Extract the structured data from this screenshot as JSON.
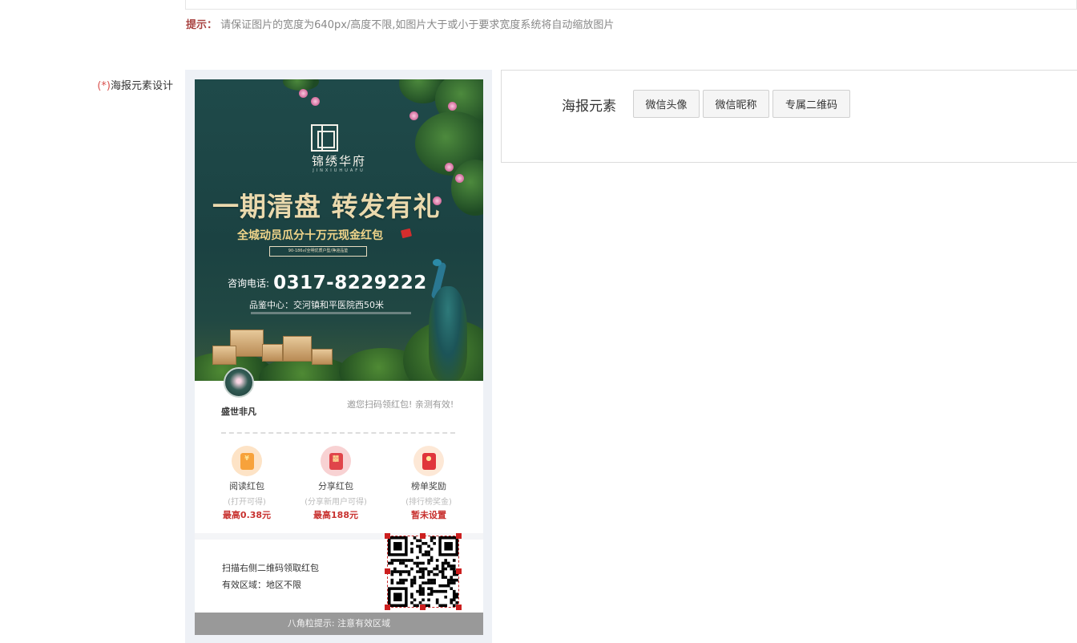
{
  "hint": {
    "label": "提示：",
    "text": "请保证图片的宽度为640px/高度不限,如图片大于或小于要求宽度系统将自动缩放图片"
  },
  "poster_field": {
    "required_mark": "(*)",
    "label": "海报元素设计"
  },
  "poster": {
    "background": {
      "brand_name": "锦绣华府",
      "brand_subtitle": "JINXIUHUAFU",
      "headline": "一期清盘 转发有礼",
      "sub_headline": "全城动员瓜分十万元现金红包",
      "tagline": "90-186㎡全明优质户型/挣迎品鉴",
      "phone_label": "咨询电话:",
      "phone_number": "0317-8229222",
      "address": "品鉴中心：交河镇和平医院西50米"
    },
    "nickname": "盛世非凡",
    "invite_text": "邀您扫码领红包! 亲测有效!",
    "rewards": [
      {
        "icon": "red-envelope-coin-icon",
        "glyph": "¥",
        "title": "阅读红包",
        "subtitle": "(打开可得)",
        "value": "最高0.38元",
        "icon_color": "#f7a23b",
        "bg_color": "#fde3c6"
      },
      {
        "icon": "red-envelope-gift-icon",
        "glyph": "囍",
        "title": "分享红包",
        "subtitle": "(分享新用户可得)",
        "value": "最高188元",
        "icon_color": "#e0454a",
        "bg_color": "#f8d2d3"
      },
      {
        "icon": "red-envelope-rank-icon",
        "glyph": "●",
        "title": "榜单奖励",
        "subtitle": "(排行榜奖金)",
        "value": "暂未设置",
        "icon_color": "#e0353b",
        "bg_color": "#fde8d6"
      }
    ],
    "scan_text": "扫描右侧二维码领取红包",
    "region_text": "有效区域：地区不限",
    "footer": "八角粒提示: 注意有效区域"
  },
  "elements_panel": {
    "title": "海报元素",
    "buttons": [
      "微信头像",
      "微信昵称",
      "专属二维码"
    ]
  },
  "colors": {
    "hint_label": "#a94442",
    "required": "#d9534f",
    "poster_dark": "#1f4a4a",
    "reward_value": "#c8312f",
    "handle": "#cc1f1f"
  }
}
